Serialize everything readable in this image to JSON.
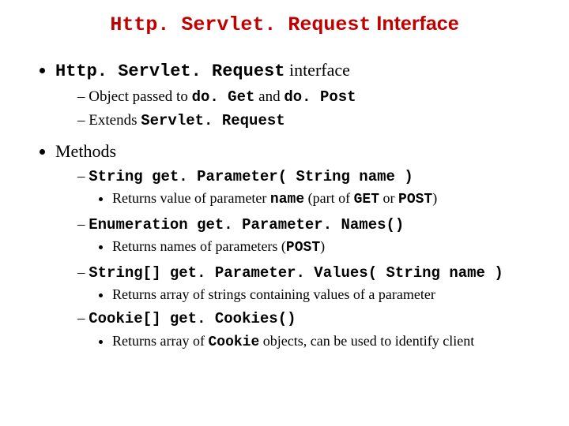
{
  "title": {
    "code": "Http. Servlet. Request",
    "suffix": " Interface"
  },
  "b1": {
    "code": "Http. Servlet. Request",
    "suffix": " interface",
    "sub1": {
      "pre": "Object passed to ",
      "c1": "do. Get",
      "mid": " and ",
      "c2": "do. Post"
    },
    "sub2": {
      "pre": "Extends ",
      "c1": "Servlet. Request"
    }
  },
  "b2": {
    "label": "Methods",
    "m1": {
      "sig": "String get. Parameter( String name )",
      "desc_pre": "Returns value of parameter ",
      "desc_c1": "name",
      "desc_mid": " (part of ",
      "desc_c2": "GET",
      "desc_or": " or ",
      "desc_c3": "POST",
      "desc_end": ")"
    },
    "m2": {
      "sig": "Enumeration get. Parameter. Names()",
      "desc_pre": "Returns names of parameters (",
      "desc_c1": "POST",
      "desc_end": ")"
    },
    "m3": {
      "sig": "String[] get. Parameter. Values( String name )",
      "desc": "Returns array of strings containing values of a parameter"
    },
    "m4": {
      "sig": "Cookie[] get. Cookies()",
      "desc_pre": "Returns array of ",
      "desc_c1": "Cookie",
      "desc_end": " objects, can be used to identify client"
    }
  }
}
